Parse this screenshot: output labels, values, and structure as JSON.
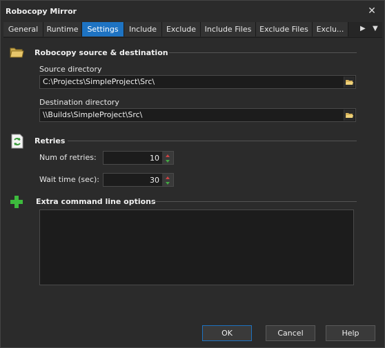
{
  "window": {
    "title": "Robocopy Mirror",
    "close_glyph": "✕"
  },
  "tabs": [
    {
      "label": "General"
    },
    {
      "label": "Runtime"
    },
    {
      "label": "Settings",
      "active": true
    },
    {
      "label": "Include"
    },
    {
      "label": "Exclude"
    },
    {
      "label": "Include Files"
    },
    {
      "label": "Exclude Files"
    },
    {
      "label": "Exclu..."
    }
  ],
  "tab_nav": {
    "scroll_glyph": "▶",
    "menu_glyph": "▼"
  },
  "source_section": {
    "title": "Robocopy source & destination",
    "icon": "folder-icon",
    "source_label": "Source directory",
    "source_value": "C:\\Projects\\SimpleProject\\Src\\",
    "dest_label": "Destination directory",
    "dest_value": "\\\\Builds\\SimpleProject\\Src\\"
  },
  "retries_section": {
    "title": "Retries",
    "icon": "retry-document-icon",
    "num_label": "Num of retries:",
    "num_value": "10",
    "wait_label": "Wait time (sec):",
    "wait_value": "30"
  },
  "extra_section": {
    "title": "Extra command line options",
    "icon": "plus-icon",
    "value": ""
  },
  "buttons": {
    "ok": "OK",
    "cancel": "Cancel",
    "help": "Help"
  },
  "colors": {
    "accent": "#1e73c2",
    "background": "#2b2b2b",
    "plus_green": "#3dbb3d",
    "folder_yellow": "#e7c66b"
  }
}
